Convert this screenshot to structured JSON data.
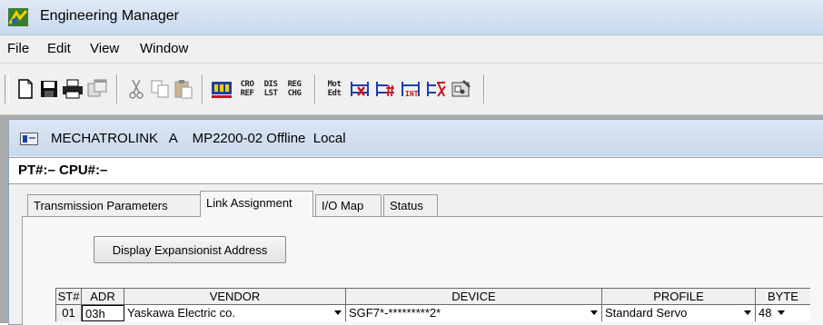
{
  "app": {
    "title": "Engineering Manager"
  },
  "menu": {
    "items": [
      "File",
      "Edit",
      "View",
      "Window"
    ]
  },
  "toolbar": {
    "text_buttons": [
      {
        "label": "CRO\nREF"
      },
      {
        "label": "DIS\nLST"
      },
      {
        "label": "REG\nCHG"
      },
      {
        "label": "Mot\nEdt"
      }
    ]
  },
  "child_window": {
    "title": "MECHATROLINK   A    MP2200-02 Offline  Local",
    "ptcpu": "PT#:– CPU#:–"
  },
  "tabs": [
    {
      "label": "Transmission Parameters",
      "active": false
    },
    {
      "label": "Link Assignment",
      "active": true
    },
    {
      "label": "I/O Map",
      "active": false
    },
    {
      "label": "Status",
      "active": false
    }
  ],
  "display_button": {
    "label": "Display Expansionist Address"
  },
  "table": {
    "headers": [
      "ST#",
      "ADR",
      "VENDOR",
      "DEVICE",
      "PROFILE",
      "BYTE"
    ],
    "rows": [
      {
        "st": "01",
        "adr": "03h",
        "vendor": "Yaskawa Electric co.",
        "device": "SGF7*-*********2*",
        "profile": "Standard Servo",
        "byte": "48"
      }
    ]
  },
  "colors": {
    "titlebar": "#c9d9ee",
    "mdi_background": "#ababab",
    "icon_red": "#c4161c",
    "icon_blue": "#1f3fa8"
  }
}
